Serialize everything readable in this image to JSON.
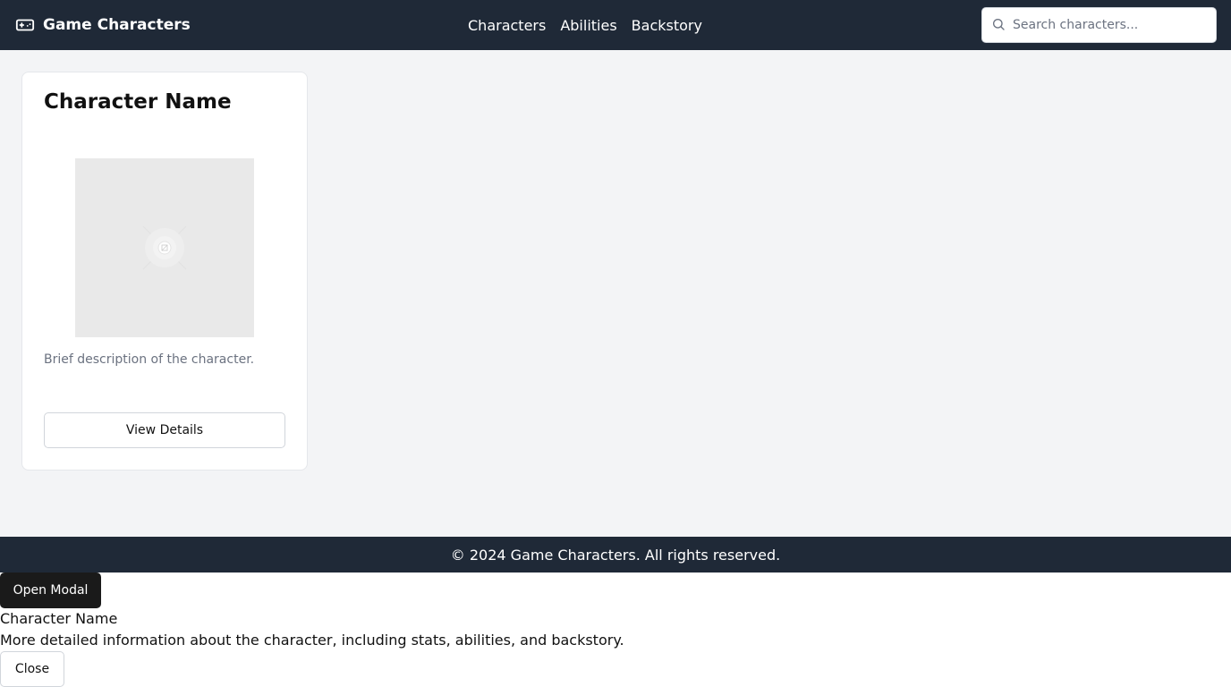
{
  "header": {
    "brand_icon": "gamepad-icon",
    "brand_title": "Game Characters",
    "nav": [
      {
        "label": "Characters"
      },
      {
        "label": "Abilities"
      },
      {
        "label": "Backstory"
      }
    ],
    "search": {
      "icon": "search-icon",
      "placeholder": "Search characters...",
      "value": ""
    }
  },
  "card": {
    "title": "Character Name",
    "image_icon": "image-placeholder-icon",
    "description": "Brief description of the character.",
    "button_label": "View Details"
  },
  "footer": {
    "text": "© 2024 Game Characters. All rights reserved."
  },
  "modal": {
    "open_label": "Open Modal",
    "title": "Character Name",
    "body": "More detailed information about the character, including stats, abilities, and backstory.",
    "close_label": "Close"
  },
  "colors": {
    "header_bg": "#1f2937",
    "page_bg": "#f3f4f6",
    "card_bg": "#ffffff",
    "placeholder_bg": "#e9e9e9",
    "muted_text": "#6b7280",
    "dark_button": "#1a1a1a"
  }
}
